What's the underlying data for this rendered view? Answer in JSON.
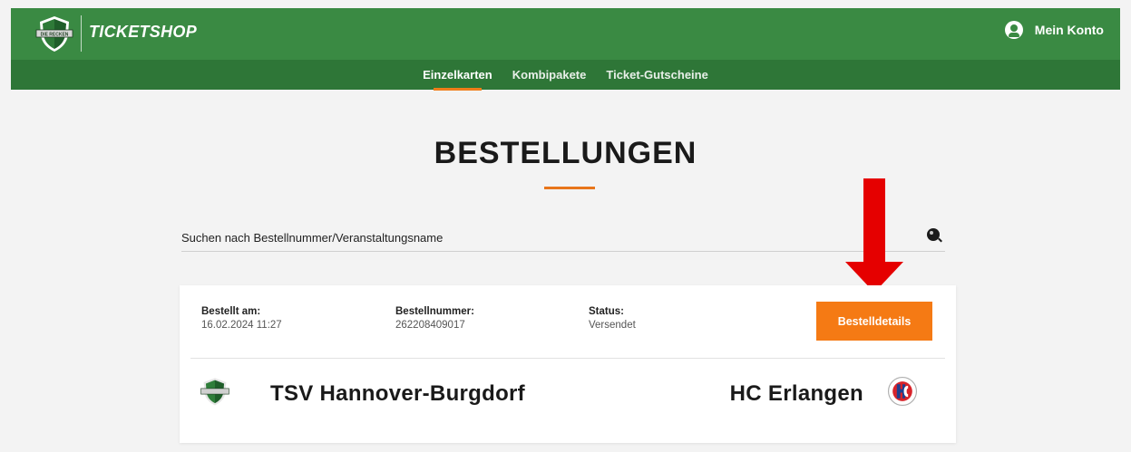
{
  "header": {
    "brand": "TICKETSHOP",
    "logo_text": "DIE RECKEN",
    "account_label": "Mein Konto"
  },
  "nav": {
    "tabs": [
      {
        "label": "Einzelkarten",
        "active": true
      },
      {
        "label": "Kombipakete",
        "active": false
      },
      {
        "label": "Ticket-Gutscheine",
        "active": false
      }
    ]
  },
  "main": {
    "title": "BESTELLUNGEN",
    "search_placeholder": "Suchen nach Bestellnummer/Veranstaltungsname"
  },
  "order": {
    "ordered_label": "Bestellt am:",
    "ordered_value": "16.02.2024 11:27",
    "number_label": "Bestellnummer:",
    "number_value": "262208409017",
    "status_label": "Status:",
    "status_value": "Versendet",
    "details_button": "Bestelldetails",
    "home_team": "TSV Hannover-Burgdorf",
    "away_team": "HC Erlangen"
  },
  "colors": {
    "header_green": "#3a8a43",
    "subnav_green": "#2e7637",
    "accent_orange": "#f57a14",
    "annotation_red": "#e50000"
  },
  "icons": [
    "recken-shield-icon",
    "user-icon",
    "search-icon",
    "red-arrow-annotation",
    "hc-erlangen-logo-icon"
  ]
}
